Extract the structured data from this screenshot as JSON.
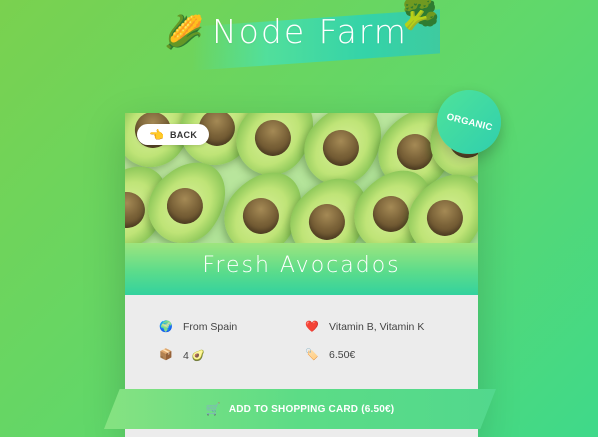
{
  "header": {
    "title": "Node Farm",
    "emoji_left": "🌽",
    "emoji_right": "🥦"
  },
  "product": {
    "name": "Fresh Avocados",
    "badge": "ORGANIC",
    "back_label": "BACK",
    "back_icon": "👈",
    "from": "From Spain",
    "from_icon": "🌍",
    "nutrients": "Vitamin B, Vitamin K",
    "nutrients_icon": "❤️",
    "quantity": "4 🥑",
    "quantity_icon": "📦",
    "price": "6.50€",
    "price_icon": "🏷️",
    "cta_label": "ADD TO SHOPPING CARD (6.50€)",
    "cta_icon": "🛒"
  },
  "colors": {
    "background_start": "#7ad14f",
    "background_end": "#3fd98a",
    "accent": "#2fcfae",
    "card": "#ececec"
  }
}
